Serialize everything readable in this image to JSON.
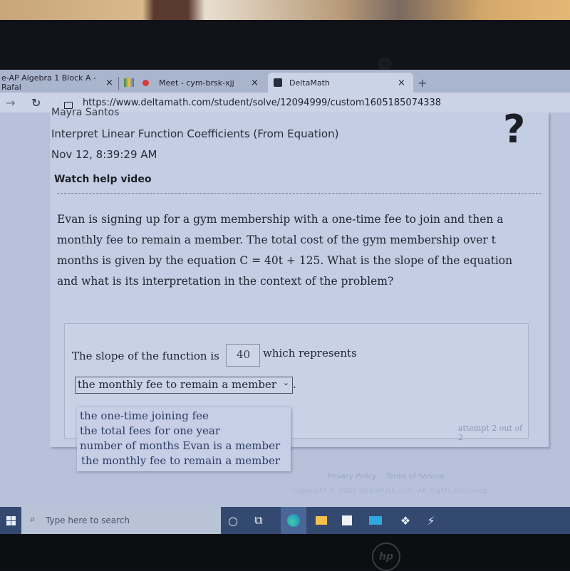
{
  "browser": {
    "tabs": [
      {
        "label": "e-AP Algebra 1 Block A - Rafal",
        "active": false
      },
      {
        "label": "Meet - cym-brsk-xjj",
        "active": false,
        "recording": true
      },
      {
        "label": "DeltaMath",
        "active": true
      }
    ],
    "new_tab": "+",
    "close": "×",
    "url": "https://www.deltamath.com/student/solve/12094999/custom1605185074338"
  },
  "header": {
    "student_name": "Mayra Santos",
    "assignment_title": "Interpret Linear Function Coefficients (From Equation)",
    "timestamp": "Nov 12, 8:39:29 AM",
    "help_link": "Watch help video",
    "help_icon": "?"
  },
  "problem": {
    "line1": "Evan is signing up for a gym membership with a one-time fee to join and then a",
    "line2": "monthly fee to remain a member. The total cost of the gym membership over t",
    "line3": "months is given by the equation C = 40t + 125. What is the slope of the equation",
    "line4": "and what is its interpretation in the context of the problem?"
  },
  "answer": {
    "prefix": "The slope of the function is",
    "slope_value": "40",
    "suffix": "which represents",
    "selected": "the monthly fee to remain a member",
    "period": ".",
    "options": [
      "the one-time joining fee",
      "the total fees for one year",
      "number of months Evan is a member",
      "the monthly fee to remain a member"
    ],
    "attempt": "attempt 2 out of 2"
  },
  "footer": {
    "privacy": "Privacy Policy",
    "terms": "Terms of Service",
    "copyright": "Copyright © 2020 DeltaMath.com. All Rights Reserved."
  },
  "taskbar": {
    "search_placeholder": "Type here to search"
  },
  "laptop": {
    "brand": "hp"
  }
}
